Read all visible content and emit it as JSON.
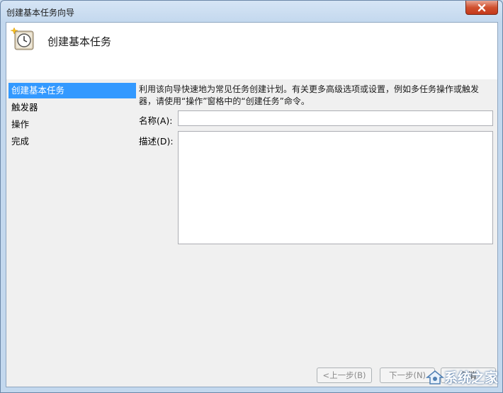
{
  "window": {
    "title": "创建基本任务向导"
  },
  "header": {
    "title": "创建基本任务"
  },
  "nav": {
    "items": [
      {
        "label": "创建基本任务"
      },
      {
        "label": "触发器"
      },
      {
        "label": "操作"
      },
      {
        "label": "完成"
      }
    ]
  },
  "content": {
    "intro": "利用该向导快速地为常见任务创建计划。有关更多高级选项或设置，例如多任务操作或触发器，请使用“操作”窗格中的“创建任务”命令。",
    "name_label": "名称(A):",
    "name_value": "",
    "desc_label": "描述(D):",
    "desc_value": ""
  },
  "footer": {
    "back_label": "<上一步(B)",
    "next_label": "下一步(N)",
    "cancel_label": "取消"
  },
  "watermark": {
    "text": "系统之家"
  },
  "colors": {
    "selection": "#3399ff",
    "close_button": "#c4381a"
  }
}
